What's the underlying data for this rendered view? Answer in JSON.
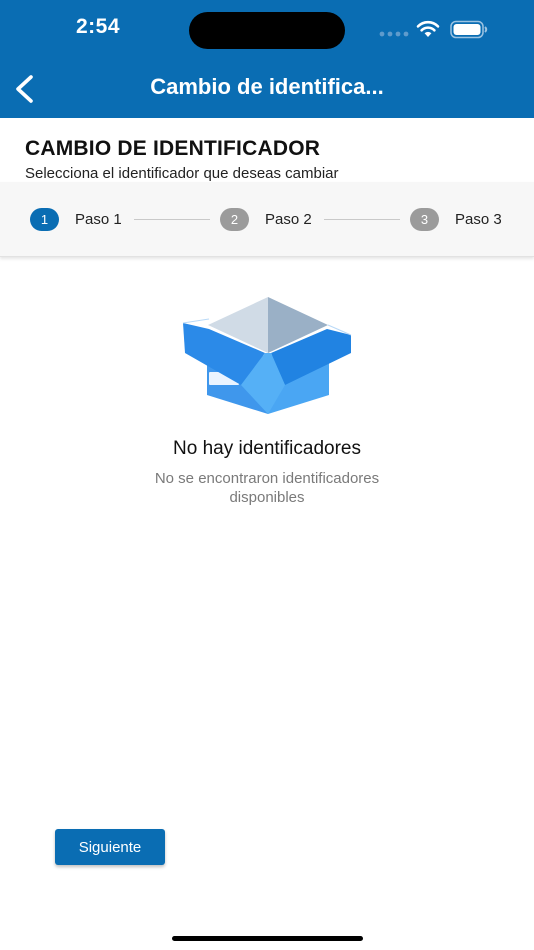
{
  "status_bar": {
    "time": "2:54"
  },
  "nav": {
    "title": "Cambio de identifica...",
    "back_icon": "chevron-left-icon"
  },
  "header": {
    "title": "CAMBIO DE IDENTIFICADOR",
    "subtitle": "Selecciona el identificador que deseas cambiar"
  },
  "stepper": {
    "steps": [
      {
        "number": "1",
        "label": "Paso 1",
        "active": true
      },
      {
        "number": "2",
        "label": "Paso 2",
        "active": false
      },
      {
        "number": "3",
        "label": "Paso 3",
        "active": false
      }
    ]
  },
  "empty_state": {
    "icon": "open-box-icon",
    "title": "No hay identificadores",
    "description": "No se encontraron identificadores disponibles"
  },
  "actions": {
    "next_label": "Siguiente"
  },
  "colors": {
    "primary": "#0a6db3",
    "inactive_step": "#9b9b9b",
    "muted_text": "#7a7a7a"
  }
}
